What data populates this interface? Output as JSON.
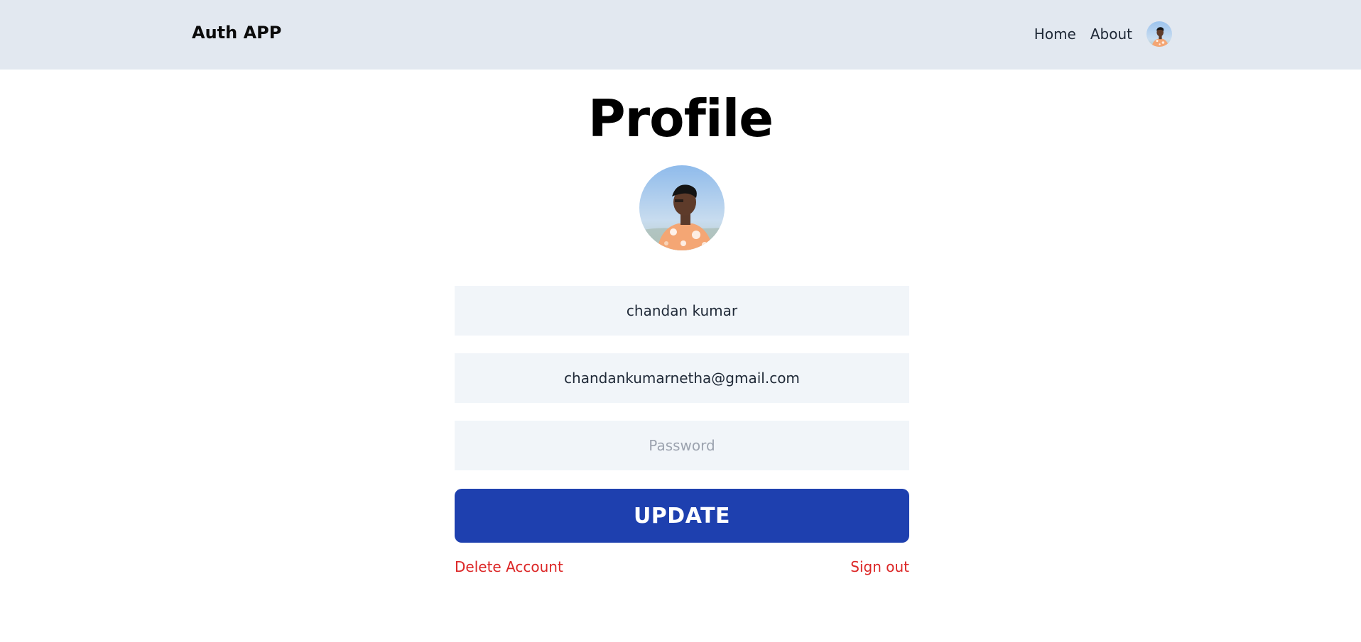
{
  "header": {
    "brand": "Auth APP",
    "nav": {
      "home_label": "Home",
      "about_label": "About"
    },
    "avatar_icon": "user-photo"
  },
  "profile": {
    "title": "Profile",
    "avatar_icon": "user-photo",
    "name_value": "chandan kumar",
    "email_value": "chandankumarnetha@gmail.com",
    "password_placeholder": "Password",
    "update_label": "UPDATE",
    "delete_label": "Delete Account",
    "signout_label": "Sign out"
  },
  "colors": {
    "header_bg": "#e2e8f0",
    "input_bg": "#f1f5f9",
    "button_bg": "#1e40af",
    "danger": "#dc2626"
  }
}
